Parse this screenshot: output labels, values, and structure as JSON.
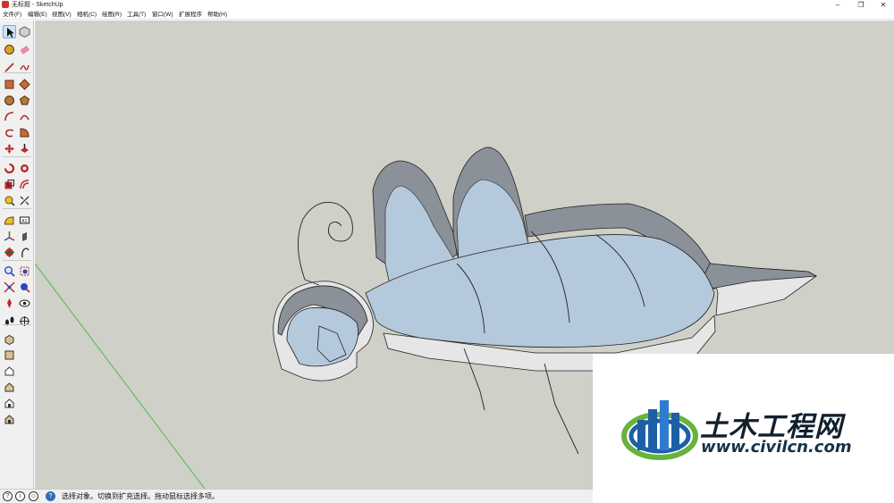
{
  "window": {
    "title": "无标题 - SketchUp",
    "minimize_glyph": "–",
    "restore_glyph": "❐",
    "close_glyph": "✕"
  },
  "menu": [
    "文件(F)",
    "编辑(E)",
    "视图(V)",
    "相机(C)",
    "绘图(R)",
    "工具(T)",
    "窗口(W)",
    "扩展程序",
    "帮助(H)"
  ],
  "toolbar": {
    "tools": [
      "select-tool",
      "component-tool",
      "paint-bucket-tool",
      "eraser-tool",
      "line-tool",
      "freehand-tool",
      "rectangle-tool",
      "rotated-rectangle-tool",
      "circle-tool",
      "polygon-tool",
      "arc-tool",
      "two-point-arc-tool",
      "three-point-arc-tool",
      "pie-tool",
      "move-tool",
      "push-pull-tool",
      "rotate-tool",
      "follow-me-tool",
      "scale-tool",
      "offset-tool",
      "tape-measure-tool",
      "dimension-tool",
      "protractor-tool",
      "text-tool",
      "axes-tool",
      "3d-text-tool",
      "orbit-tool",
      "pan-tool",
      "zoom-tool",
      "zoom-window-tool",
      "zoom-extents-tool",
      "previous-view-tool",
      "position-camera-tool",
      "look-around-tool",
      "walk-tool",
      "section-plane-tool"
    ],
    "views": [
      "iso-view",
      "top-view",
      "front-view",
      "right-view",
      "back-view",
      "left-view"
    ]
  },
  "statusbar": {
    "hint": "选择对象。切换到扩充选择。拖动鼠标选择多项。",
    "icons": [
      "geo-location-icon",
      "credits-icon",
      "user-icon",
      "help-icon"
    ]
  },
  "watermark": {
    "brand_cn": "土木工程网",
    "url": "www.civilcn.com"
  },
  "colors": {
    "viewport_bg": "#cfd0c8",
    "face_front": "#b5c9dc",
    "face_back": "#8a9198",
    "face_side": "#e6e6e6",
    "green_axis": "#52b84e"
  }
}
